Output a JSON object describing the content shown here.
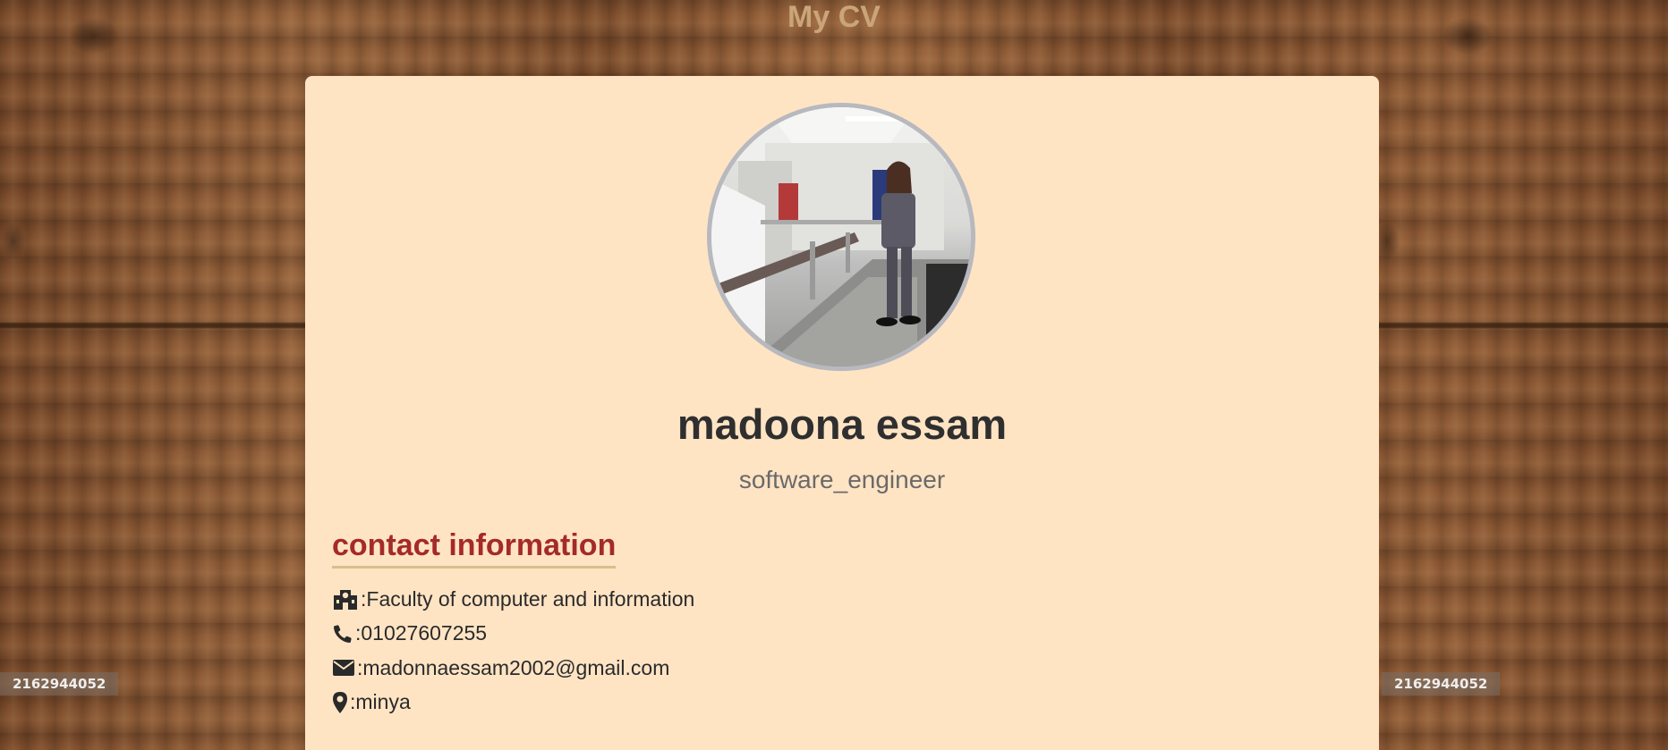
{
  "page": {
    "title": "My CV",
    "watermark_left": "2162944052",
    "watermark_right": "2162944052"
  },
  "profile": {
    "name": "madoona essam",
    "job_title": "software_engineer",
    "photo_icon": "profile-photo"
  },
  "contact": {
    "heading": "contact information",
    "items": [
      {
        "icon": "school-icon",
        "text": ":Faculty of computer and information"
      },
      {
        "icon": "phone-icon",
        "text": ":01027607255"
      },
      {
        "icon": "envelope-icon",
        "text": ":madonnaessam2002@gmail.com"
      },
      {
        "icon": "location-pin-icon",
        "text": ":minya"
      }
    ]
  },
  "colors": {
    "card_background": "#ffe4c4",
    "heading_accent": "#a52a2a",
    "heading_underline": "#d4bf8e",
    "title_color": "#caa57a"
  }
}
